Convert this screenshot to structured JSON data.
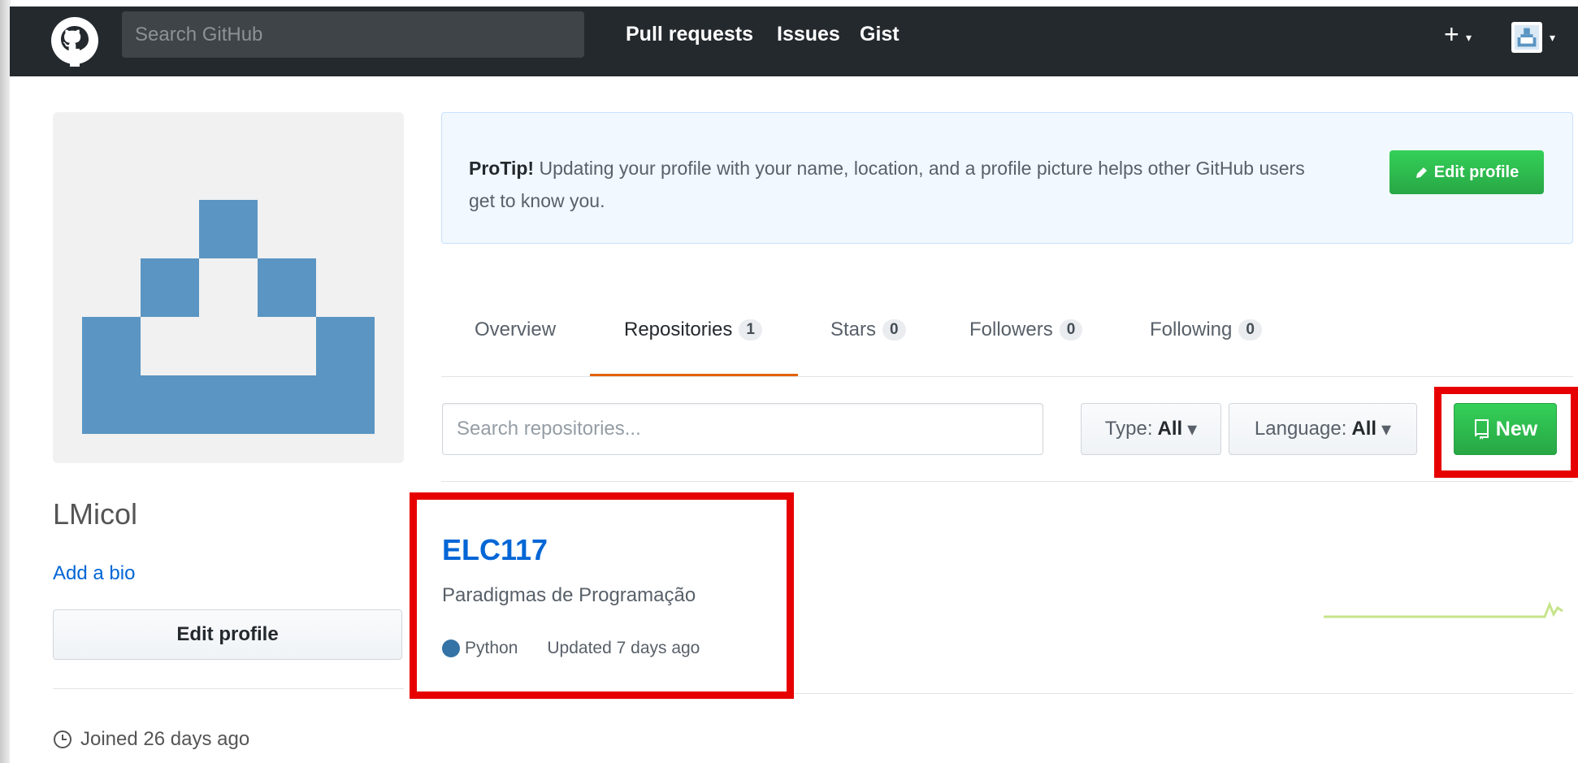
{
  "header": {
    "search_placeholder": "Search GitHub",
    "nav": [
      "Pull requests",
      "Issues",
      "Gist"
    ],
    "icons": {
      "logo": "github-octocat-icon",
      "plus": "+",
      "caret": "▾"
    }
  },
  "profile": {
    "username": "LMicol",
    "add_bio": "Add a bio",
    "edit_button": "Edit profile",
    "joined": "Joined 26 days ago"
  },
  "protip": {
    "label": "ProTip!",
    "text": " Updating your profile with your name, location, and a profile picture helps other GitHub users get to know you.",
    "button": "Edit profile"
  },
  "tabs": [
    {
      "label": "Overview",
      "count": null
    },
    {
      "label": "Repositories",
      "count": "1",
      "selected": true
    },
    {
      "label": "Stars",
      "count": "0"
    },
    {
      "label": "Followers",
      "count": "0"
    },
    {
      "label": "Following",
      "count": "0"
    }
  ],
  "filters": {
    "search_placeholder": "Search repositories...",
    "type_label": "Type:",
    "type_value": "All",
    "language_label": "Language:",
    "language_value": "All",
    "new_button": "New"
  },
  "repositories": [
    {
      "name": "ELC117",
      "description": "Paradigmas de Programação",
      "language": "Python",
      "language_color": "#3572a5",
      "updated": "Updated 7 days ago"
    }
  ],
  "colors": {
    "header_bg": "#24292e",
    "link": "#0366d6",
    "green_button": "#28a745",
    "tab_underline": "#e36209",
    "highlight": "#e60000"
  }
}
